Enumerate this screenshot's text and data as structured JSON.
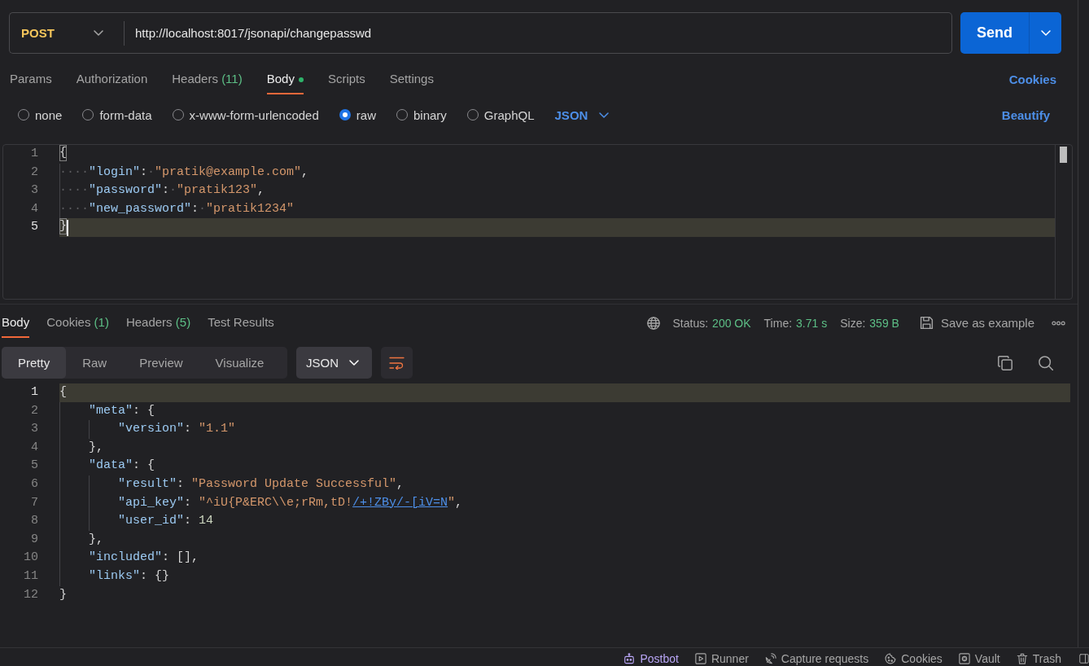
{
  "request": {
    "method": "POST",
    "url": "http://localhost:8017/jsonapi/changepasswd",
    "send_label": "Send"
  },
  "request_tabs": [
    {
      "label": "Params",
      "selected": false,
      "indicator": false
    },
    {
      "label": "Authorization",
      "selected": false,
      "indicator": false
    },
    {
      "label": "Headers",
      "count": "(11)",
      "selected": false,
      "indicator": false
    },
    {
      "label": "Body",
      "selected": true,
      "indicator": true
    },
    {
      "label": "Scripts",
      "selected": false,
      "indicator": false
    },
    {
      "label": "Settings",
      "selected": false,
      "indicator": false
    }
  ],
  "request_cookies_link": "Cookies",
  "body_types": [
    {
      "label": "none",
      "selected": false
    },
    {
      "label": "form-data",
      "selected": false
    },
    {
      "label": "x-www-form-urlencoded",
      "selected": false
    },
    {
      "label": "raw",
      "selected": true
    },
    {
      "label": "binary",
      "selected": false
    },
    {
      "label": "GraphQL",
      "selected": false
    }
  ],
  "body_language": "JSON",
  "beautify_label": "Beautify",
  "request_body": {
    "lines": [
      {
        "number": "1",
        "active": false,
        "cursor": false,
        "tokens": [
          {
            "kind": "match",
            "text": "{"
          }
        ]
      },
      {
        "number": "2",
        "active": false,
        "cursor": false,
        "tokens": [
          {
            "kind": "indent",
            "text": "····"
          },
          {
            "kind": "key",
            "text": "\"login\""
          },
          {
            "kind": "punct",
            "text": ":"
          },
          {
            "kind": "ws",
            "text": "·"
          },
          {
            "kind": "string",
            "text": "\"pratik@example.com\""
          },
          {
            "kind": "punct",
            "text": ","
          }
        ]
      },
      {
        "number": "3",
        "active": false,
        "cursor": false,
        "tokens": [
          {
            "kind": "indent",
            "text": "····"
          },
          {
            "kind": "key",
            "text": "\"password\""
          },
          {
            "kind": "punct",
            "text": ":"
          },
          {
            "kind": "ws",
            "text": "·"
          },
          {
            "kind": "string",
            "text": "\"pratik123\""
          },
          {
            "kind": "punct",
            "text": ","
          }
        ]
      },
      {
        "number": "4",
        "active": false,
        "cursor": false,
        "tokens": [
          {
            "kind": "indent",
            "text": "····"
          },
          {
            "kind": "key",
            "text": "\"new_password\""
          },
          {
            "kind": "punct",
            "text": ":"
          },
          {
            "kind": "ws",
            "text": "·"
          },
          {
            "kind": "string",
            "text": "\"pratik1234\""
          }
        ]
      },
      {
        "number": "5",
        "active": true,
        "cursor": true,
        "tokens": [
          {
            "kind": "match",
            "text": "}"
          }
        ]
      }
    ]
  },
  "response_tabs": [
    {
      "label": "Body",
      "selected": true
    },
    {
      "label": "Cookies",
      "count": "(1)",
      "selected": false
    },
    {
      "label": "Headers",
      "count": "(5)",
      "selected": false
    },
    {
      "label": "Test Results",
      "selected": false
    }
  ],
  "response_meta": {
    "status_label": "Status:",
    "status": "200 OK",
    "time_label": "Time:",
    "time": "3.71 s",
    "size_label": "Size:",
    "size": "359 B",
    "save_label": "Save as example"
  },
  "view_modes": [
    {
      "label": "Pretty",
      "selected": true
    },
    {
      "label": "Raw",
      "selected": false
    },
    {
      "label": "Preview",
      "selected": false
    },
    {
      "label": "Visualize",
      "selected": false
    }
  ],
  "response_format": "JSON",
  "wrap_lines": true,
  "response_body": {
    "lines": [
      {
        "number": "1",
        "active": true,
        "tokens": [
          {
            "kind": "punct",
            "text": "{"
          }
        ]
      },
      {
        "number": "2",
        "active": false,
        "tokens": [
          {
            "kind": "indent"
          },
          {
            "kind": "key",
            "text": "\"meta\""
          },
          {
            "kind": "punct",
            "text": ": {"
          }
        ]
      },
      {
        "number": "3",
        "active": false,
        "tokens": [
          {
            "kind": "indent"
          },
          {
            "kind": "indent"
          },
          {
            "kind": "key",
            "text": "\"version\""
          },
          {
            "kind": "punct",
            "text": ": "
          },
          {
            "kind": "string",
            "text": "\"1.1\""
          }
        ]
      },
      {
        "number": "4",
        "active": false,
        "tokens": [
          {
            "kind": "indent"
          },
          {
            "kind": "punct",
            "text": "},"
          }
        ]
      },
      {
        "number": "5",
        "active": false,
        "tokens": [
          {
            "kind": "indent"
          },
          {
            "kind": "key",
            "text": "\"data\""
          },
          {
            "kind": "punct",
            "text": ": {"
          }
        ]
      },
      {
        "number": "6",
        "active": false,
        "tokens": [
          {
            "kind": "indent"
          },
          {
            "kind": "indent"
          },
          {
            "kind": "key",
            "text": "\"result\""
          },
          {
            "kind": "punct",
            "text": ": "
          },
          {
            "kind": "string",
            "text": "\"Password Update Successful\""
          },
          {
            "kind": "punct",
            "text": ","
          }
        ]
      },
      {
        "number": "7",
        "active": false,
        "tokens": [
          {
            "kind": "indent"
          },
          {
            "kind": "indent"
          },
          {
            "kind": "key",
            "text": "\"api_key\""
          },
          {
            "kind": "punct",
            "text": ": "
          },
          {
            "kind": "string",
            "text": "\"^iU{P&ERC\\\\e;rRm,tD!"
          },
          {
            "kind": "link",
            "text": "/+!ZBy/-[iV=N"
          },
          {
            "kind": "string",
            "text": "\""
          },
          {
            "kind": "punct",
            "text": ","
          }
        ]
      },
      {
        "number": "8",
        "active": false,
        "tokens": [
          {
            "kind": "indent"
          },
          {
            "kind": "indent"
          },
          {
            "kind": "key",
            "text": "\"user_id\""
          },
          {
            "kind": "punct",
            "text": ": "
          },
          {
            "kind": "number",
            "text": "14"
          }
        ]
      },
      {
        "number": "9",
        "active": false,
        "tokens": [
          {
            "kind": "indent"
          },
          {
            "kind": "punct",
            "text": "},"
          }
        ]
      },
      {
        "number": "10",
        "active": false,
        "tokens": [
          {
            "kind": "indent"
          },
          {
            "kind": "key",
            "text": "\"included\""
          },
          {
            "kind": "punct",
            "text": ": [],"
          }
        ]
      },
      {
        "number": "11",
        "active": false,
        "tokens": [
          {
            "kind": "indent"
          },
          {
            "kind": "key",
            "text": "\"links\""
          },
          {
            "kind": "punct",
            "text": ": {}"
          }
        ]
      },
      {
        "number": "12",
        "active": false,
        "tokens": [
          {
            "kind": "punct",
            "text": "}"
          }
        ]
      }
    ]
  },
  "status_bar": [
    {
      "kind": "postbot",
      "label": "Postbot"
    },
    {
      "kind": "runner",
      "label": "Runner"
    },
    {
      "kind": "capture",
      "label": "Capture requests"
    },
    {
      "kind": "cookies",
      "label": "Cookies"
    },
    {
      "kind": "vault",
      "label": "Vault"
    },
    {
      "kind": "trash",
      "label": "Trash"
    },
    {
      "kind": "layout"
    }
  ]
}
